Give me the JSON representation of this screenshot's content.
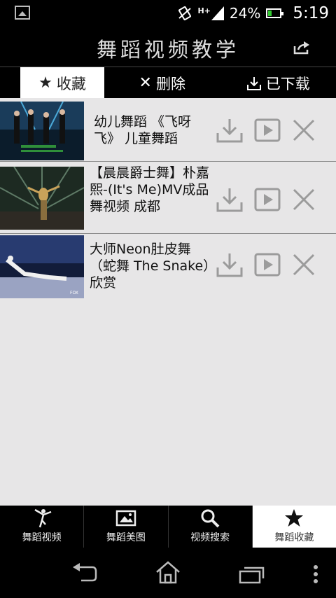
{
  "status": {
    "battery": "24%",
    "time": "5:19",
    "signal_label": "H+"
  },
  "app": {
    "title": "舞蹈视频教学"
  },
  "tabs": [
    {
      "label": "收藏",
      "icon": "star-icon"
    },
    {
      "label": "删除",
      "icon": "x-icon"
    },
    {
      "label": "已下载",
      "icon": "download-icon"
    }
  ],
  "videos": [
    {
      "title": "幼儿舞蹈 《飞呀飞》 儿童舞蹈"
    },
    {
      "title": "【晨晨爵士舞】朴嘉熙-(It's Me)MV成品舞视频 成都"
    },
    {
      "title": "大师Neon肚皮舞（蛇舞 The Snake）欣赏"
    }
  ],
  "bottom_nav": [
    {
      "label": "舞蹈视频",
      "icon": "dancer-icon"
    },
    {
      "label": "舞蹈美图",
      "icon": "picture-icon"
    },
    {
      "label": "视频搜索",
      "icon": "search-icon"
    },
    {
      "label": "舞蹈收藏",
      "icon": "star-icon"
    }
  ],
  "colors": {
    "list_bg": "#e7e6e7",
    "icon_gray": "#9b9b9b",
    "battery_green": "#33cc33"
  }
}
